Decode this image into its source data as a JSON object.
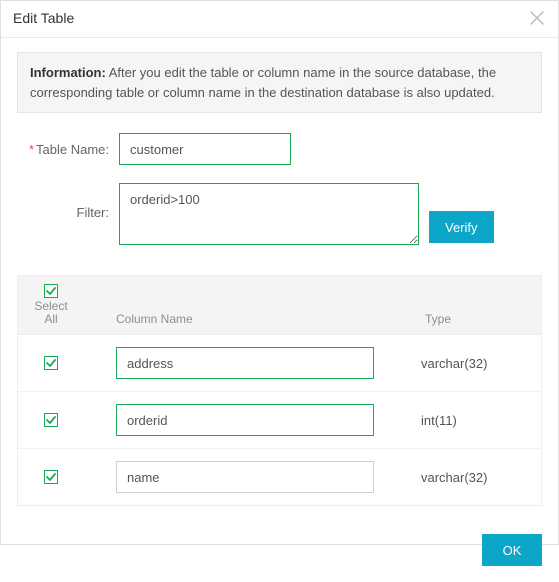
{
  "dialog": {
    "title": "Edit Table"
  },
  "info": {
    "label": "Information:",
    "text": " After you edit the table or column name in the source database, the corresponding table or column name in the destination database is also updated."
  },
  "form": {
    "tableNameLabel": "Table Name:",
    "tableNameValue": "customer",
    "filterLabel": "Filter:",
    "filterValue": "orderid>100",
    "verifyLabel": "Verify"
  },
  "grid": {
    "selectLabel1": "Select",
    "selectLabel2": "All",
    "columnNameLabel": "Column Name",
    "typeLabel": "Type",
    "rows": [
      {
        "name": "address",
        "type": "varchar(32)",
        "checked": true,
        "style": "green"
      },
      {
        "name": "orderid",
        "type": "int(11)",
        "checked": true,
        "style": "green"
      },
      {
        "name": "name",
        "type": "varchar(32)",
        "checked": true,
        "style": "gray"
      }
    ]
  },
  "footer": {
    "okLabel": "OK"
  }
}
